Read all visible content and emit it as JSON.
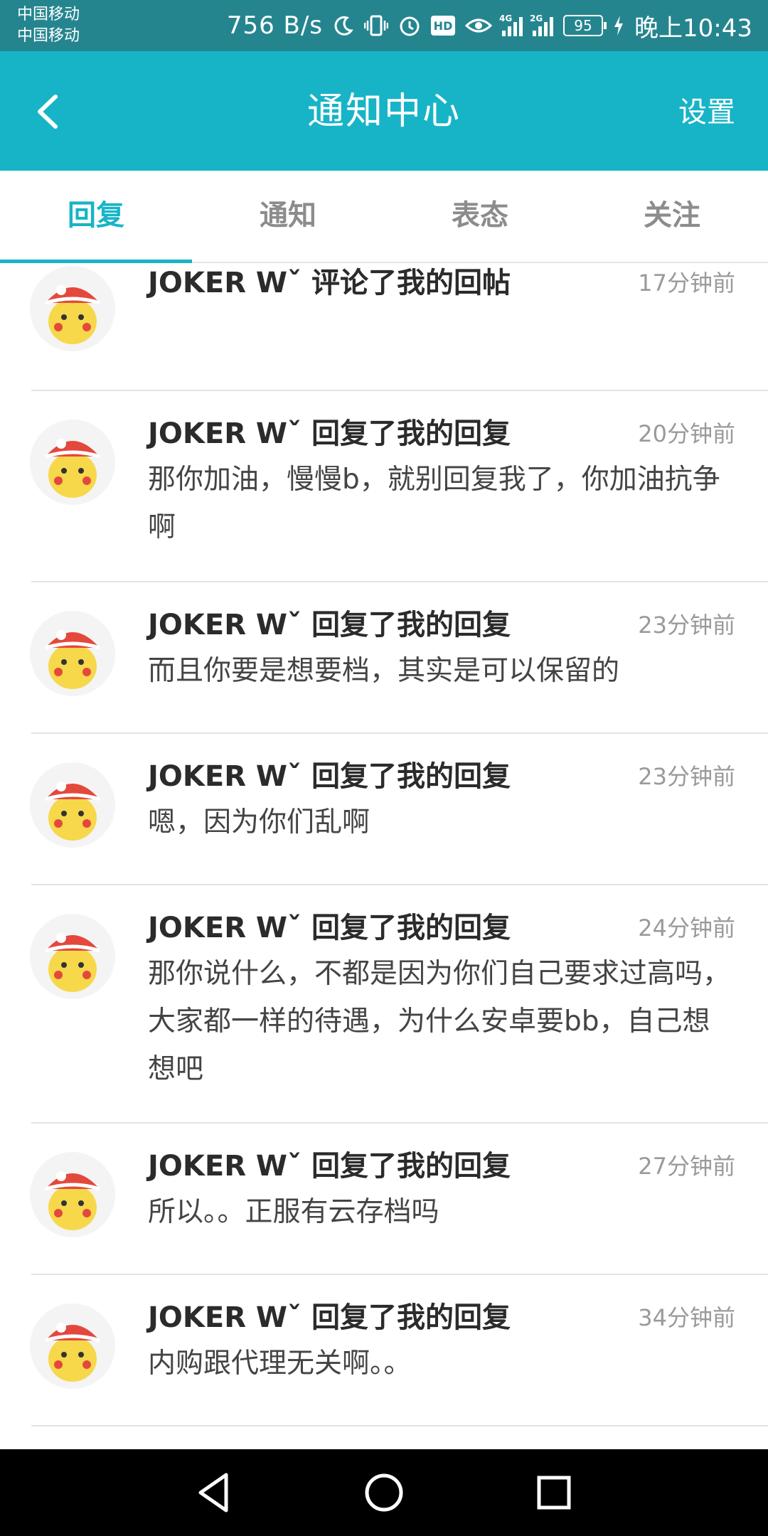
{
  "status_bar": {
    "carrier1": "中国移动",
    "carrier2": "中国移动",
    "speed": "756 B/s",
    "hd": "HD",
    "net1": "4G",
    "net2": "2G",
    "battery": "95",
    "time": "晚上10:43",
    "icons": [
      "moon-icon",
      "vibrate-icon",
      "alarm-icon",
      "eye-icon",
      "charging-icon"
    ]
  },
  "header": {
    "title": "通知中心",
    "settings_label": "设置",
    "background_color": "#17b4c7"
  },
  "tabs": [
    {
      "label": "回复",
      "active": true
    },
    {
      "label": "通知",
      "active": false
    },
    {
      "label": "表态",
      "active": false
    },
    {
      "label": "关注",
      "active": false
    }
  ],
  "items": [
    {
      "title": "JOKER Wˇ 评论了我的回帖",
      "time": "17分钟前",
      "content": ""
    },
    {
      "title": "JOKER Wˇ 回复了我的回复",
      "time": "20分钟前",
      "content": "那你加油，慢慢b，就别回复我了，你加油抗争啊"
    },
    {
      "title": "JOKER Wˇ 回复了我的回复",
      "time": "23分钟前",
      "content": "而且你要是想要档，其实是可以保留的"
    },
    {
      "title": "JOKER Wˇ 回复了我的回复",
      "time": "23分钟前",
      "content": "嗯，因为你们乱啊"
    },
    {
      "title": "JOKER Wˇ 回复了我的回复",
      "time": "24分钟前",
      "content": "那你说什么，不都是因为你们自己要求过高吗，大家都一样的待遇，为什么安卓要bb，自己想想吧"
    },
    {
      "title": "JOKER Wˇ 回复了我的回复",
      "time": "27分钟前",
      "content": "所以。。正服有云存档吗"
    },
    {
      "title": "JOKER Wˇ 回复了我的回复",
      "time": "34分钟前",
      "content": "内购跟代理无关啊。。"
    }
  ],
  "nav_icons": [
    "back-triangle-icon",
    "home-circle-icon",
    "recents-square-icon"
  ]
}
